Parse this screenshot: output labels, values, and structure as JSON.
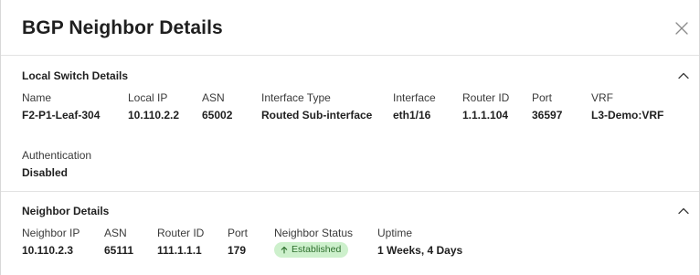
{
  "dialog": {
    "title": "BGP Neighbor Details",
    "close_icon": "close-icon"
  },
  "local_switch": {
    "title": "Local Switch Details",
    "collapse_icon": "chevron-up-icon",
    "fields": {
      "name": {
        "label": "Name",
        "value": "F2-P1-Leaf-304"
      },
      "local_ip": {
        "label": "Local IP",
        "value": "10.110.2.2"
      },
      "asn": {
        "label": "ASN",
        "value": "65002"
      },
      "interface_type": {
        "label": "Interface Type",
        "value": "Routed Sub-interface"
      },
      "interface": {
        "label": "Interface",
        "value": "eth1/16"
      },
      "router_id": {
        "label": "Router ID",
        "value": "1.1.1.104"
      },
      "port": {
        "label": "Port",
        "value": "36597"
      },
      "vrf": {
        "label": "VRF",
        "value": "L3-Demo:VRF"
      },
      "authentication": {
        "label": "Authentication",
        "value": "Disabled"
      }
    }
  },
  "neighbor": {
    "title": "Neighbor Details",
    "collapse_icon": "chevron-up-icon",
    "fields": {
      "neighbor_ip": {
        "label": "Neighbor IP",
        "value": "10.110.2.3"
      },
      "asn": {
        "label": "ASN",
        "value": "65111"
      },
      "router_id": {
        "label": "Router ID",
        "value": "111.1.1.1"
      },
      "port": {
        "label": "Port",
        "value": "179"
      },
      "neighbor_status": {
        "label": "Neighbor Status",
        "value": "Established",
        "icon": "arrow-up-icon",
        "color": "#2c6e2c",
        "background": "#cdf0cc"
      },
      "uptime": {
        "label": "Uptime",
        "value": "1 Weeks, 4 Days"
      }
    }
  }
}
